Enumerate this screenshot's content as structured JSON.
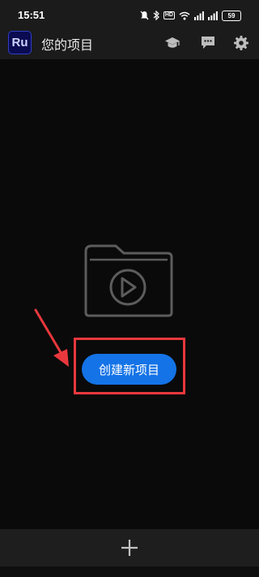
{
  "status_bar": {
    "time": "15:51",
    "hd": "HD",
    "battery": "59"
  },
  "app_bar": {
    "logo": "Ru",
    "title": "您的项目"
  },
  "icons": {
    "learn": "graduation-cap-icon",
    "feedback": "speech-bubble-icon",
    "settings": "gear-icon",
    "add": "plus-icon"
  },
  "main": {
    "create_button_label": "创建新项目"
  },
  "colors": {
    "accent": "#1473e6",
    "annotation": "#e8383d",
    "logo_bg": "#0b0b52"
  }
}
